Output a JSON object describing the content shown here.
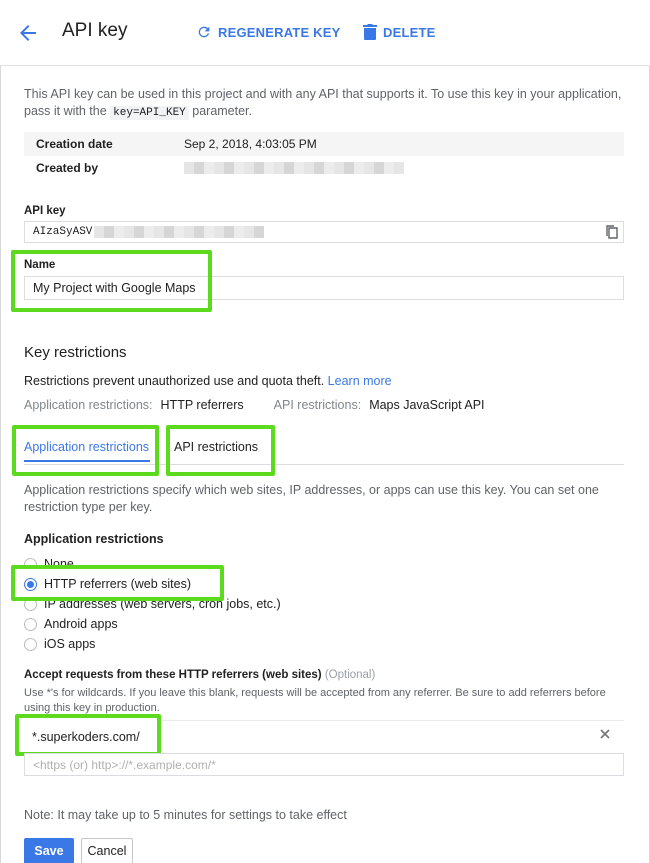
{
  "header": {
    "title": "API key",
    "regenerate_label": "REGENERATE KEY",
    "delete_label": "DELETE",
    "back_icon": "arrow-back-icon",
    "regenerate_icon": "refresh-icon",
    "delete_icon": "trash-icon",
    "accent": "#3b78e7"
  },
  "intro": {
    "text_before": "This API key can be used in this project and with any API that supports it. To use this key in your application, pass it with the ",
    "code": "key=API_KEY",
    "text_after": " parameter."
  },
  "meta": {
    "creation_label": "Creation date",
    "creation_value": "Sep 2, 2018, 4:03:05 PM",
    "created_by_label": "Created by"
  },
  "api_key": {
    "label": "API key",
    "value_prefix": "AIzaSyASV",
    "copy_icon": "copy-icon"
  },
  "name": {
    "label": "Name",
    "value": "My Project with Google Maps"
  },
  "restrictions": {
    "heading": "Key restrictions",
    "description": "Restrictions prevent unauthorized use and quota theft. ",
    "learn_more": "Learn more",
    "app_label": "Application restrictions:",
    "app_value": "HTTP referrers",
    "api_label": "API restrictions:",
    "api_value": "Maps JavaScript API"
  },
  "tabs": {
    "app": "Application restrictions",
    "api": "API restrictions"
  },
  "app_tab": {
    "description": "Application restrictions specify which web sites, IP addresses, or apps can use this key. You can set one restriction type per key.",
    "subheading": "Application restrictions",
    "options": [
      "None",
      "HTTP referrers (web sites)",
      "IP addresses (web servers, cron jobs, etc.)",
      "Android apps",
      "iOS apps"
    ],
    "selected": "HTTP referrers (web sites)"
  },
  "referrers": {
    "label": "Accept requests from these HTTP referrers (web sites)",
    "optional": "(Optional)",
    "hint": "Use *'s for wildcards. If you leave this blank, requests will be accepted from any referrer. Be sure to add referrers before using this key in production.",
    "items": [
      "*.superkoders.com/"
    ],
    "placeholder": "<https (or) http>://*.example.com/*",
    "clear_icon": "close-icon"
  },
  "note": "Note: It may take up to 5 minutes for settings to take effect",
  "buttons": {
    "save": "Save",
    "cancel": "Cancel"
  },
  "highlight_color": "#5cdb1e"
}
